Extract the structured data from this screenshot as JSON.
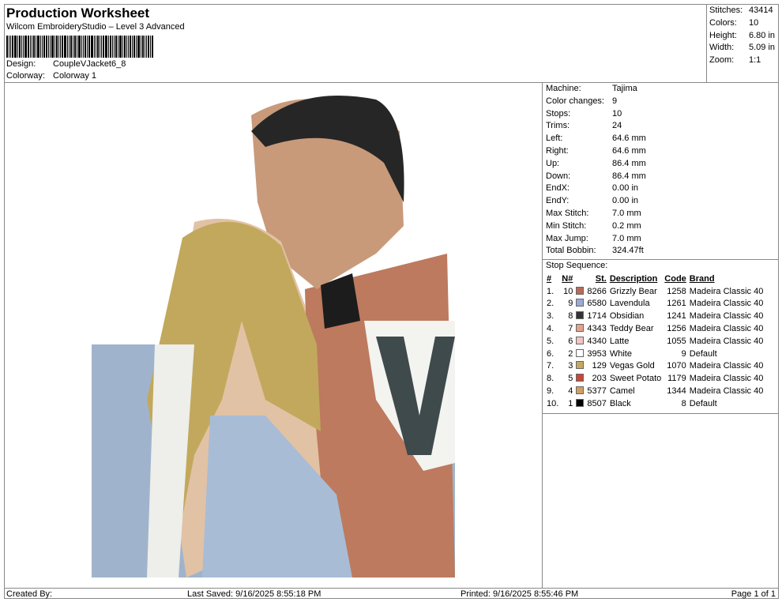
{
  "header": {
    "title": "Production Worksheet",
    "subtitle": "Wilcom EmbroideryStudio – Level 3 Advanced",
    "design_label": "Design:",
    "design": "CoupleVJacket6_8",
    "colorway_label": "Colorway:",
    "colorway": "Colorway 1"
  },
  "stats": [
    {
      "label": "Stitches:",
      "value": "43414"
    },
    {
      "label": "Colors:",
      "value": "10"
    },
    {
      "label": "Height:",
      "value": "6.80 in"
    },
    {
      "label": "Width:",
      "value": "5.09 in"
    },
    {
      "label": "Zoom:",
      "value": "1:1"
    }
  ],
  "machine": [
    {
      "label": "Machine:",
      "value": "Tajima"
    },
    {
      "label": "Color changes:",
      "value": "9"
    },
    {
      "label": "Stops:",
      "value": "10"
    },
    {
      "label": "Trims:",
      "value": "24"
    },
    {
      "label": "Left:",
      "value": "64.6 mm"
    },
    {
      "label": "Right:",
      "value": "64.6 mm"
    },
    {
      "label": "Up:",
      "value": "86.4 mm"
    },
    {
      "label": "Down:",
      "value": "86.4 mm"
    },
    {
      "label": "EndX:",
      "value": "0.00 in"
    },
    {
      "label": "EndY:",
      "value": "0.00 in"
    },
    {
      "label": "Max Stitch:",
      "value": "7.0 mm"
    },
    {
      "label": "Min Stitch:",
      "value": "0.2 mm"
    },
    {
      "label": "Max Jump:",
      "value": "7.0 mm"
    },
    {
      "label": "Total Bobbin:",
      "value": "324.47ft"
    }
  ],
  "stop_sequence": {
    "title": "Stop Sequence:",
    "headers": [
      "#",
      "N#",
      "St.",
      "Description",
      "Code",
      "Brand"
    ],
    "rows": [
      {
        "idx": "1.",
        "n": "10",
        "color": "#b86a58",
        "st": "8266",
        "desc": "Grizzly Bear",
        "code": "1258",
        "brand": "Madeira Classic 40"
      },
      {
        "idx": "2.",
        "n": "9",
        "color": "#9aaad8",
        "st": "6580",
        "desc": "Lavendula",
        "code": "1261",
        "brand": "Madeira Classic 40"
      },
      {
        "idx": "3.",
        "n": "8",
        "color": "#333333",
        "st": "1714",
        "desc": "Obsidian",
        "code": "1241",
        "brand": "Madeira Classic 40"
      },
      {
        "idx": "4.",
        "n": "7",
        "color": "#e8a088",
        "st": "4343",
        "desc": "Teddy Bear",
        "code": "1256",
        "brand": "Madeira Classic 40"
      },
      {
        "idx": "5.",
        "n": "6",
        "color": "#f3c4c4",
        "st": "4340",
        "desc": "Latte",
        "code": "1055",
        "brand": "Madeira Classic 40"
      },
      {
        "idx": "6.",
        "n": "2",
        "color": "#ffffff",
        "st": "3953",
        "desc": "White",
        "code": "9",
        "brand": "Default"
      },
      {
        "idx": "7.",
        "n": "3",
        "color": "#c8a860",
        "st": "129",
        "desc": "Vegas Gold",
        "code": "1070",
        "brand": "Madeira Classic 40"
      },
      {
        "idx": "8.",
        "n": "5",
        "color": "#c84838",
        "st": "203",
        "desc": "Sweet Potato",
        "code": "1179",
        "brand": "Madeira Classic 40"
      },
      {
        "idx": "9.",
        "n": "4",
        "color": "#d0a060",
        "st": "5377",
        "desc": "Camel",
        "code": "1344",
        "brand": "Madeira Classic 40"
      },
      {
        "idx": "10.",
        "n": "1",
        "color": "#000000",
        "st": "8507",
        "desc": "Black",
        "code": "8",
        "brand": "Default"
      }
    ]
  },
  "footer": {
    "created": "Created By:",
    "saved": "Last Saved: 9/16/2025 8:55:18 PM",
    "printed": "Printed: 9/16/2025 8:55:46 PM",
    "page": "Page 1 of 1"
  }
}
